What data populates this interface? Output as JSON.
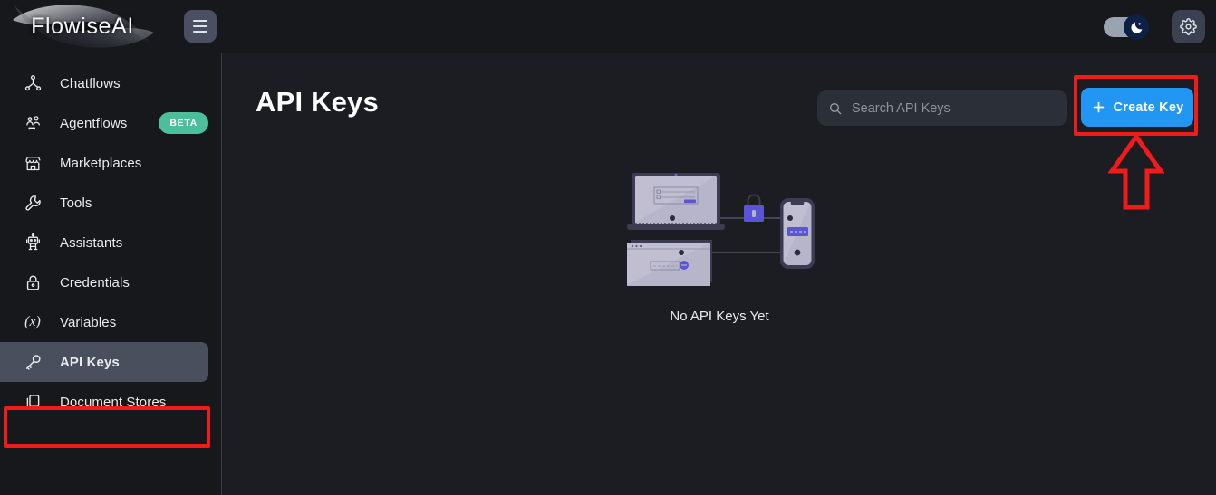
{
  "topbar": {
    "logo_text": "FlowiseAI",
    "menu_icon": "hamburger-menu-icon",
    "theme_toggle_icon": "moon-icon",
    "settings_icon": "gear-icon"
  },
  "sidebar": {
    "items": [
      {
        "label": "Chatflows",
        "icon": "chatflow-node-icon",
        "selected": false,
        "badge": null
      },
      {
        "label": "Agentflows",
        "icon": "agents-group-icon",
        "selected": false,
        "badge": "BETA"
      },
      {
        "label": "Marketplaces",
        "icon": "storefront-icon",
        "selected": false,
        "badge": null
      },
      {
        "label": "Tools",
        "icon": "wrench-icon",
        "selected": false,
        "badge": null
      },
      {
        "label": "Assistants",
        "icon": "robot-icon",
        "selected": false,
        "badge": null
      },
      {
        "label": "Credentials",
        "icon": "lock-icon",
        "selected": false,
        "badge": null
      },
      {
        "label": "Variables",
        "icon": "variable-x-icon",
        "selected": false,
        "badge": null
      },
      {
        "label": "API Keys",
        "icon": "key-icon",
        "selected": true,
        "badge": null
      },
      {
        "label": "Document Stores",
        "icon": "documents-icon",
        "selected": false,
        "badge": null
      }
    ]
  },
  "main": {
    "title": "API Keys",
    "search": {
      "placeholder": "Search API Keys",
      "value": "",
      "icon": "search-icon"
    },
    "create_button": {
      "label": "Create Key",
      "icon": "plus-icon"
    },
    "empty_state": {
      "text": "No API Keys Yet",
      "illustration": "devices-connected-with-lock-illustration"
    }
  },
  "annotations": {
    "color": "#f21b1b",
    "sidebar_highlight": "api-keys-sidebar-item",
    "button_highlight": "create-key-button",
    "arrow": "up-arrow-pointing-to-create-key-button"
  },
  "colors": {
    "accent_blue": "#2196f3",
    "badge_teal": "#4bbf9a",
    "annotation_red": "#f21b1b",
    "illustration_purple": "#5b54d6",
    "sidebar_selected": "#494f5d"
  }
}
